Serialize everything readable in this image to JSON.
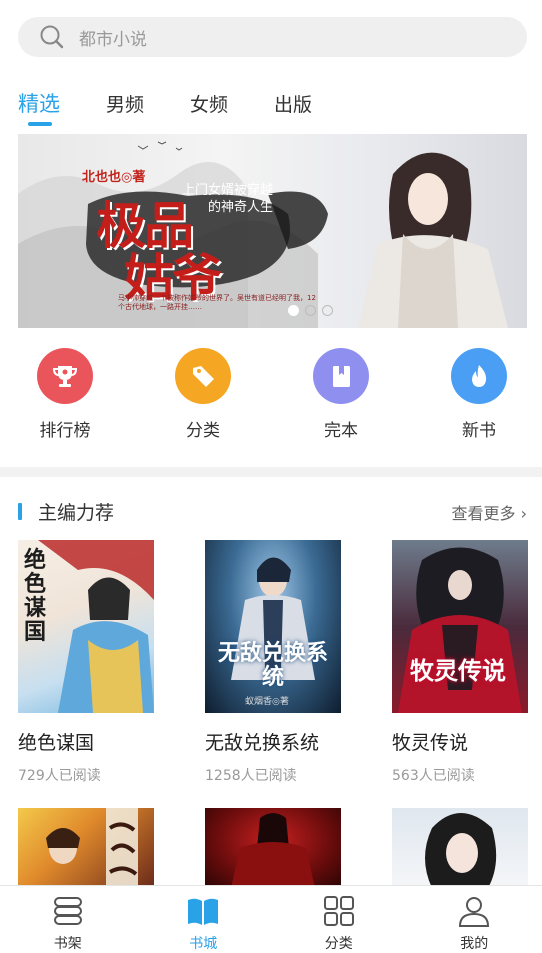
{
  "search": {
    "placeholder": "都市小说",
    "icon": "search-icon"
  },
  "tabs": [
    {
      "label": "精选",
      "active": true
    },
    {
      "label": "男频",
      "active": false
    },
    {
      "label": "女频",
      "active": false
    },
    {
      "label": "出版",
      "active": false
    }
  ],
  "banner": {
    "author": "北也也◎著",
    "subtitle_line1": "上门女婿被穿越",
    "subtitle_line2": "的神奇人生",
    "title_line1": "极品",
    "title_line2": "姑爷",
    "blurb": "马小帅穿越一个被称作姑爷的世界了。吴世有道已经明了我，12个古代地球，一路开挂……",
    "page_count": 3,
    "current_page": 1
  },
  "quick": [
    {
      "label": "排行榜",
      "icon": "trophy-icon",
      "color": "#e9555a"
    },
    {
      "label": "分类",
      "icon": "tag-icon",
      "color": "#f5a623"
    },
    {
      "label": "完本",
      "icon": "book-icon",
      "color": "#8f8ff0"
    },
    {
      "label": "新书",
      "icon": "flame-icon",
      "color": "#4a9ff5"
    }
  ],
  "section": {
    "title": "主编力荐",
    "more": "查看更多 ›"
  },
  "books": [
    {
      "name": "绝色谋国",
      "reads": "729人已阅读",
      "cover_text": "绝色谋国"
    },
    {
      "name": "无敌兑换系统",
      "reads": "1258人已阅读",
      "cover_text": "无敌兑换系统",
      "cover_author": "蚁烟香◎著"
    },
    {
      "name": "牧灵传说",
      "reads": "563人已阅读",
      "cover_text": "牧灵传说"
    }
  ],
  "nav": [
    {
      "label": "书架",
      "icon": "bookshelf-icon",
      "active": false
    },
    {
      "label": "书城",
      "icon": "bookstore-icon",
      "active": true
    },
    {
      "label": "分类",
      "icon": "category-grid-icon",
      "active": false
    },
    {
      "label": "我的",
      "icon": "profile-icon",
      "active": false
    }
  ],
  "colors": {
    "accent": "#2aa2e8"
  }
}
